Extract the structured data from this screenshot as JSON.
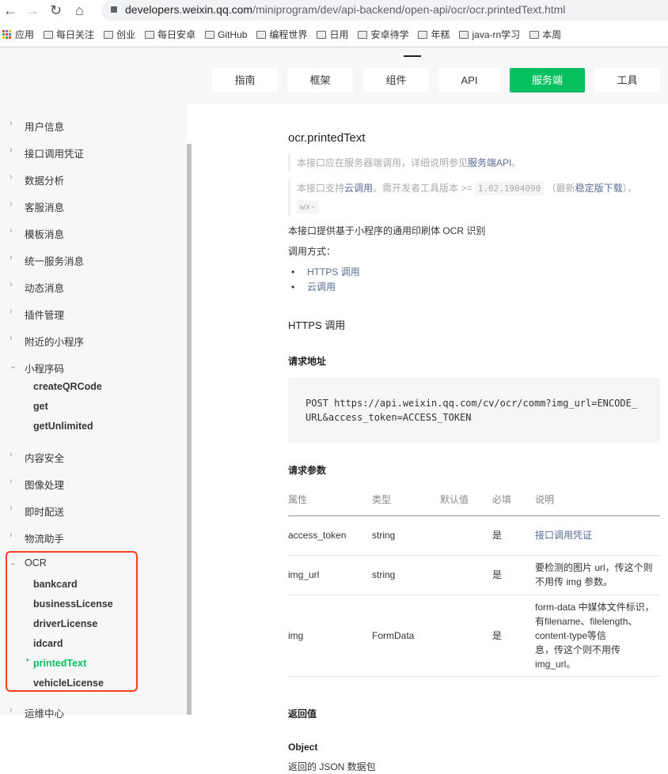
{
  "browser": {
    "url_host": "developers.weixin.qq.com",
    "url_path": "/miniprogram/dev/api-backend/open-api/ocr/ocr.printedText.html",
    "bookmarks": [
      "应用",
      "每日关注",
      "创业",
      "每日安卓",
      "GitHub",
      "编程世界",
      "日用",
      "安卓待学",
      "年糕",
      "java-rn学习",
      "本周"
    ]
  },
  "nav": {
    "tabs": [
      "指南",
      "框架",
      "组件",
      "API",
      "服务端",
      "工具"
    ],
    "active": "服务端"
  },
  "sidebar": {
    "items_top": [
      "用户信息",
      "接口调用凭证",
      "数据分析",
      "客服消息",
      "模板消息",
      "统一服务消息",
      "动态消息",
      "插件管理",
      "附近的小程序"
    ],
    "qrcode": {
      "label": "小程序码",
      "children": [
        "createQRCode",
        "get",
        "getUnlimited"
      ]
    },
    "items_mid": [
      "内容安全",
      "图像处理",
      "即时配送",
      "物流助手"
    ],
    "ocr": {
      "label": "OCR",
      "children": [
        "bankcard",
        "businessLicense",
        "driverLicense",
        "idcard",
        "printedText",
        "vehicleLicense"
      ],
      "active": "printedText"
    },
    "items_bottom": [
      "运维中心"
    ]
  },
  "main": {
    "title": "ocr.printedText",
    "note1": {
      "text": "本接口应在服务器端调用，详细说明参见",
      "link": "服务端API",
      "end": "。"
    },
    "note2": {
      "a": "本接口支持",
      "link1": "云调用",
      "b": "。需开发者工具版本 >= ",
      "version": "1.02.1904090",
      "c": "（最新",
      "link2": "稳定版下载",
      "d": "），",
      "code2": "wx-"
    },
    "desc": "本接口提供基于小程序的通用印刷体 OCR 识别",
    "call_label": "调用方式：",
    "call_methods": [
      "HTTPS 调用",
      "云调用"
    ],
    "https_heading": "HTTPS 调用",
    "url_heading": "请求地址",
    "request": "POST https://api.weixin.qq.com/cv/ocr/comm?img_url=ENCODE_URL&access_token=ACCESS_TOKEN",
    "params_heading": "请求参数",
    "table": {
      "headers": [
        "属性",
        "类型",
        "默认值",
        "必填",
        "说明"
      ],
      "rows": [
        [
          "access_token",
          "string",
          "",
          "是",
          "接口调用凭证"
        ],
        [
          "img_url",
          "string",
          "",
          "是",
          "要检测的图片 url，传这个则不用传 img 参数。"
        ],
        [
          "img",
          "FormData",
          "",
          "是",
          "form-data 中媒体文件标识，有filename、filelength、content-type等信",
          "息，传这个则不用传 img_url。"
        ]
      ]
    },
    "return_heading": "返回值",
    "object_heading": "Object",
    "return_desc": "返回的 JSON 数据包"
  }
}
